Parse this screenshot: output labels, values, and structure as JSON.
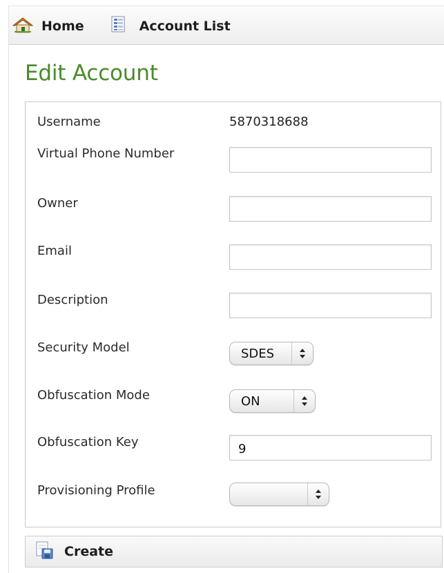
{
  "nav": {
    "home_label": "Home",
    "account_list_label": "Account List"
  },
  "page_title": "Edit Account",
  "form": {
    "username_label": "Username",
    "username_value": "5870318688",
    "virtual_phone_label": "Virtual Phone Number",
    "virtual_phone_value": "",
    "owner_label": "Owner",
    "owner_value": "",
    "email_label": "Email",
    "email_value": "",
    "description_label": "Description",
    "description_value": "",
    "security_model_label": "Security Model",
    "security_model_value": "SDES",
    "obfuscation_mode_label": "Obfuscation Mode",
    "obfuscation_mode_value": "ON",
    "obfuscation_key_label": "Obfuscation Key",
    "obfuscation_key_value": "9",
    "provisioning_profile_label": "Provisioning Profile",
    "provisioning_profile_value": ""
  },
  "footer": {
    "create_label": "Create"
  },
  "icons": {
    "home": "home-icon",
    "account_list": "list-icon",
    "create": "save-icon"
  },
  "colors": {
    "title_green": "#4a8a2a",
    "home_roof": "#c8781e"
  }
}
